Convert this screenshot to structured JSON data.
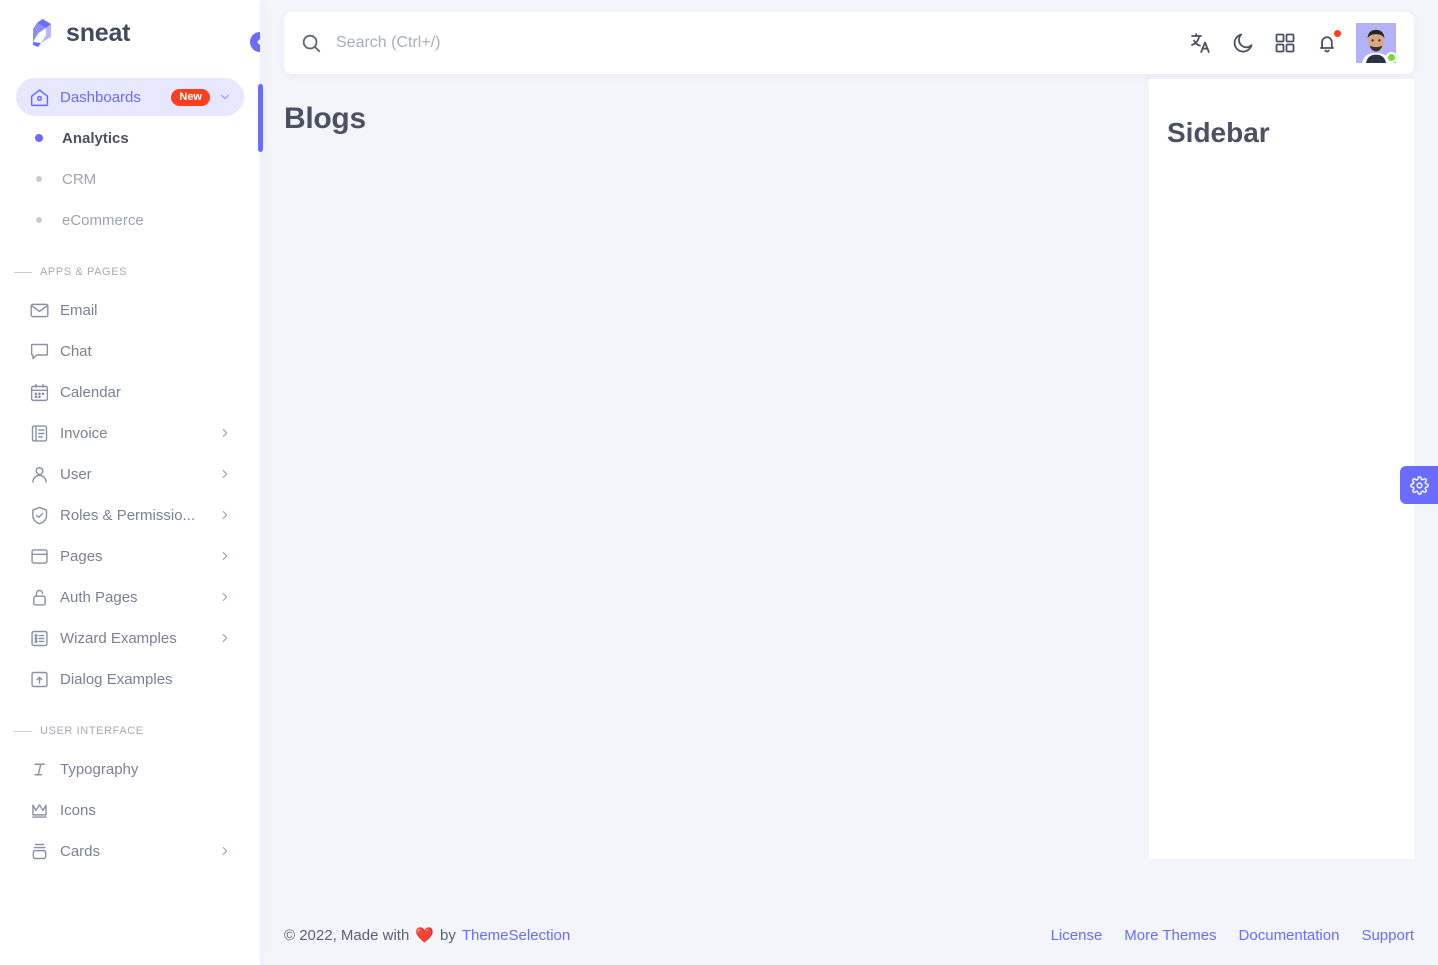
{
  "brand": {
    "name": "sneat",
    "logo_icon": "sneat-logo"
  },
  "sidebar": {
    "collapse_icon": "chevron-left-icon",
    "groups": [
      {
        "items": [
          {
            "label": "Dashboards",
            "icon": "home-icon",
            "badge": "New",
            "expandable": true,
            "active": true,
            "children": [
              {
                "label": "Analytics",
                "active": true
              },
              {
                "label": "CRM",
                "active": false
              },
              {
                "label": "eCommerce",
                "active": false
              }
            ]
          }
        ]
      },
      {
        "header": "APPS & PAGES",
        "items": [
          {
            "label": "Email",
            "icon": "mail-icon",
            "expandable": false
          },
          {
            "label": "Chat",
            "icon": "chat-icon",
            "expandable": false
          },
          {
            "label": "Calendar",
            "icon": "calendar-icon",
            "expandable": false
          },
          {
            "label": "Invoice",
            "icon": "invoice-icon",
            "expandable": true
          },
          {
            "label": "User",
            "icon": "user-icon",
            "expandable": true
          },
          {
            "label": "Roles & Permissio...",
            "icon": "shield-check-icon",
            "expandable": true
          },
          {
            "label": "Pages",
            "icon": "pages-icon",
            "expandable": true
          },
          {
            "label": "Auth Pages",
            "icon": "lock-icon",
            "expandable": true
          },
          {
            "label": "Wizard Examples",
            "icon": "list-icon",
            "expandable": true
          },
          {
            "label": "Dialog Examples",
            "icon": "dialog-icon",
            "expandable": false
          }
        ]
      },
      {
        "header": "USER INTERFACE",
        "items": [
          {
            "label": "Typography",
            "icon": "typography-icon",
            "expandable": false
          },
          {
            "label": "Icons",
            "icon": "crown-icon",
            "expandable": false
          },
          {
            "label": "Cards",
            "icon": "cards-icon",
            "expandable": true
          }
        ]
      }
    ]
  },
  "navbar": {
    "search": {
      "placeholder": "Search (Ctrl+/)",
      "value": "",
      "icon": "search-icon"
    },
    "actions": [
      {
        "name": "language-icon",
        "label": "Language"
      },
      {
        "name": "moon-icon",
        "label": "Dark mode"
      },
      {
        "name": "grid-apps-icon",
        "label": "Shortcuts"
      },
      {
        "name": "bell-icon",
        "label": "Notifications",
        "has_dot": true
      }
    ],
    "avatar": {
      "name": "user-avatar",
      "status": "online"
    }
  },
  "main": {
    "page_title": "Blogs",
    "right_panel": {
      "title": "Sidebar"
    }
  },
  "footer": {
    "copyright": "© 2022, Made with",
    "heart": "❤️",
    "by": "by",
    "brand_link": "ThemeSelection",
    "links": [
      "License",
      "More Themes",
      "Documentation",
      "Support"
    ]
  },
  "settings_fab": {
    "icon": "gear-icon"
  },
  "colors": {
    "accent": "#696cff",
    "accent_soft": "#e7e7ff",
    "badge_new": "#ff3e1d",
    "status_online": "#71dd37",
    "page_bg": "#f4f5fa",
    "text_dark": "#4b5162",
    "text_muted": "#7a8194"
  }
}
